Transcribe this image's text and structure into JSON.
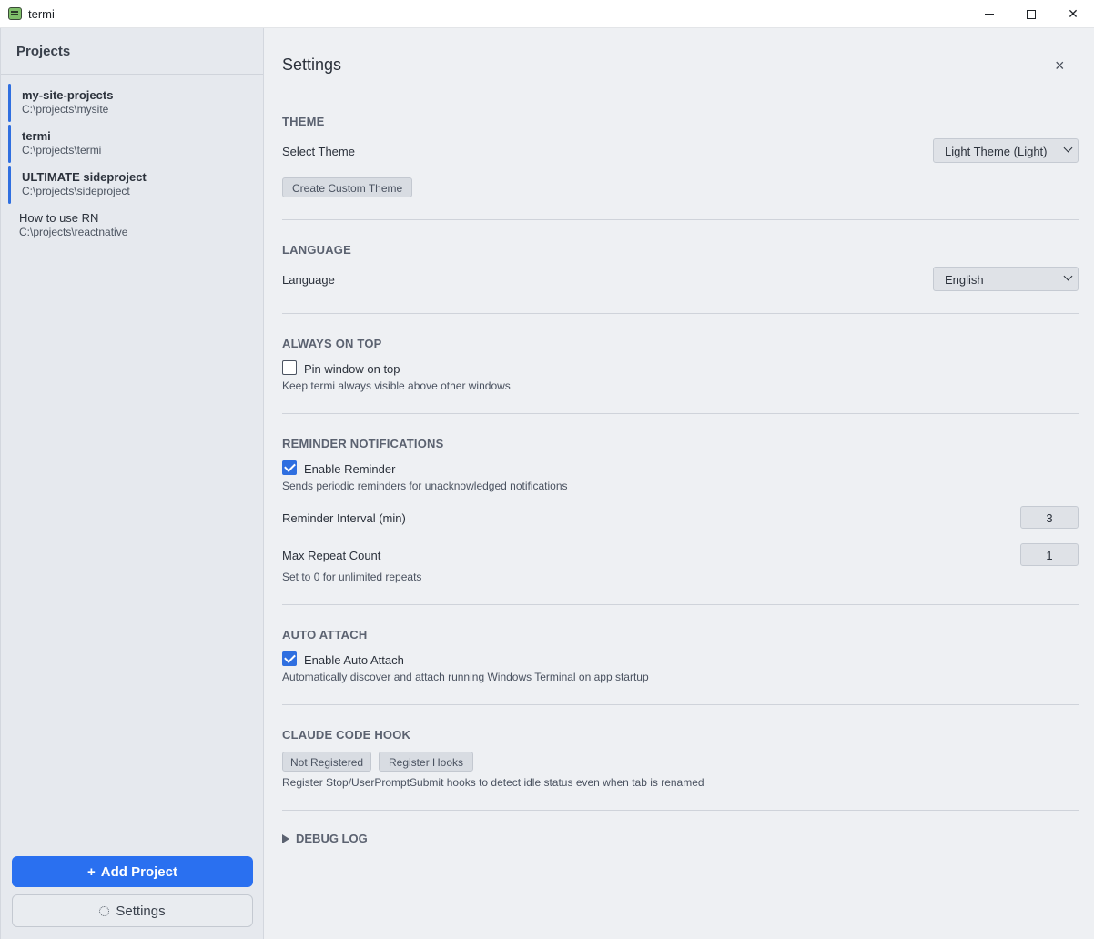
{
  "window": {
    "title": "termi"
  },
  "sidebar": {
    "header": "Projects",
    "projects": [
      {
        "name": "my-site-projects",
        "path": "C:\\projects\\mysite"
      },
      {
        "name": "termi",
        "path": "C:\\projects\\termi"
      },
      {
        "name": "ULTIMATE sideproject",
        "path": "C:\\projects\\sideproject"
      },
      {
        "name": "How to use RN",
        "path": "C:\\projects\\reactnative"
      }
    ],
    "add_label": "Add Project",
    "add_icon": "+",
    "settings_label": "Settings"
  },
  "settings": {
    "title": "Settings",
    "close_icon": "×",
    "theme": {
      "title": "THEME",
      "select_label": "Select Theme",
      "selected": "Light Theme (Light)",
      "custom_button": "Create Custom Theme"
    },
    "language": {
      "title": "LANGUAGE",
      "label": "Language",
      "selected": "English"
    },
    "always_on_top": {
      "title": "ALWAYS ON TOP",
      "checkbox_label": "Pin window on top",
      "checked": false,
      "description": "Keep termi always visible above other windows"
    },
    "reminder": {
      "title": "REMINDER NOTIFICATIONS",
      "checkbox_label": "Enable Reminder",
      "checked": true,
      "description": "Sends periodic reminders for unacknowledged notifications",
      "interval_label": "Reminder Interval (min)",
      "interval_value": "3",
      "max_repeat_label": "Max Repeat Count",
      "max_repeat_value": "1",
      "max_repeat_hint": "Set to 0 for unlimited repeats"
    },
    "auto_attach": {
      "title": "AUTO ATTACH",
      "checkbox_label": "Enable Auto Attach",
      "checked": true,
      "description": "Automatically discover and attach running Windows Terminal on app startup"
    },
    "claude_hook": {
      "title": "CLAUDE CODE HOOK",
      "status_badge": "Not Registered",
      "register_button": "Register Hooks",
      "description": "Register Stop/UserPromptSubmit hooks to detect idle status even when tab is renamed"
    },
    "debug_log": {
      "title": "DEBUG LOG"
    }
  }
}
